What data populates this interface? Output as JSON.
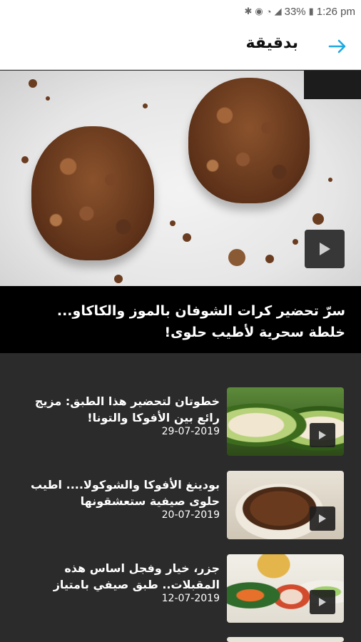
{
  "status_bar": {
    "battery": "33%",
    "time": "1:26 pm",
    "icons": [
      "bluetooth-icon",
      "alarm-icon",
      "wifi-icon",
      "signal-icon",
      "battery-icon"
    ]
  },
  "app_bar": {
    "title": "بدقيقة",
    "back_icon": "arrow-right-icon",
    "accent_color": "#1fa8e0"
  },
  "featured": {
    "title": "سرّ تحضير كرات الشوفان بالموز والكاكاو... خلطة سحرية لأطيب حلوى!",
    "has_video": true
  },
  "articles": [
    {
      "title": "خطوتان لتحضير هذا الطبق: مزيج رائع بين الأفوكا والتونا!",
      "date": "29-07-2019",
      "has_video": true
    },
    {
      "title": "بودينغ الأفوكا والشوكولا.... اطيب حلوى صيفية ستعشقونها",
      "date": "20-07-2019",
      "has_video": true
    },
    {
      "title": "جزر، خيار وفجل اساس هذه المقبلات.. طبق صيفي بامتياز",
      "date": "12-07-2019",
      "has_video": true
    }
  ]
}
